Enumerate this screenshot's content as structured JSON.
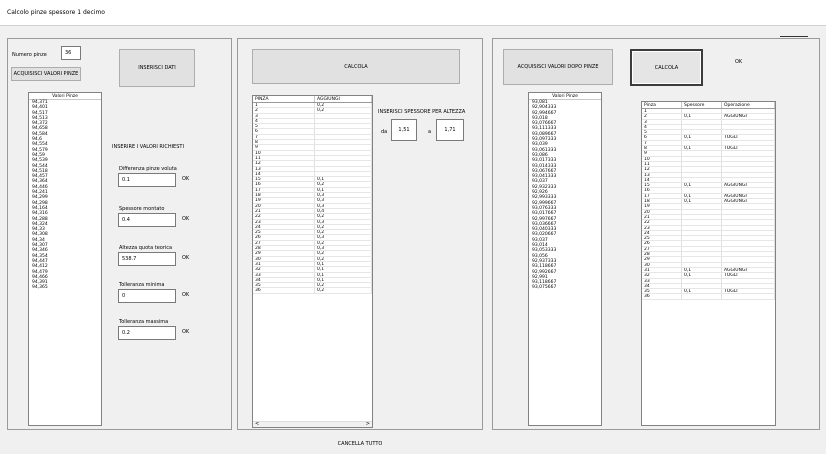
{
  "window": {
    "title": "Calcolo pinze spessore 1 decimo"
  },
  "left": {
    "numero_pinze_label": "Numero pinze",
    "numero_pinze_value": "36",
    "acquisisci_label": "ACQUISISCI VALORI PINZE",
    "inserisci_dati_label": "INSERISCI DATI",
    "valori_pinze_header": "Valori Pinze",
    "valori_pinze": [
      "94,371",
      "94,401",
      "94,517",
      "94,513",
      "94,372",
      "94,658",
      "94,584",
      "94,6",
      "94,554",
      "94,579",
      "94,59",
      "94,539",
      "94,544",
      "94,518",
      "94,457",
      "94,364",
      "94,446",
      "94,241",
      "94,299",
      "94,298",
      "94,164",
      "94,316",
      "94,288",
      "94,324",
      "94,33",
      "94,308",
      "94,34",
      "94,307",
      "94,346",
      "94,354",
      "94,447",
      "94,412",
      "94,479",
      "94,466",
      "94,391",
      "94,365"
    ],
    "inserire_label": "INSERIRE I VALORI RICHIESTI",
    "fields": [
      {
        "label": "Differenza pinze voluta",
        "value": "0.1",
        "ok": "OK"
      },
      {
        "label": "Spessore montato",
        "value": "0.4",
        "ok": "OK"
      },
      {
        "label": "Altezza quota teorica",
        "value": "538.7",
        "ok": "OK"
      },
      {
        "label": "Tolleranza minima",
        "value": "0",
        "ok": "OK"
      },
      {
        "label": "Tolleranza massima",
        "value": "0.2",
        "ok": "OK"
      }
    ]
  },
  "middle": {
    "calcola_label": "CALCOLA",
    "columns": [
      "PINZA",
      "AGGIUNGI"
    ],
    "rows": [
      [
        "1",
        "0,2"
      ],
      [
        "2",
        "0,2"
      ],
      [
        "3",
        ""
      ],
      [
        "4",
        ""
      ],
      [
        "5",
        ""
      ],
      [
        "6",
        ""
      ],
      [
        "7",
        ""
      ],
      [
        "8",
        ""
      ],
      [
        "9",
        ""
      ],
      [
        "10",
        ""
      ],
      [
        "11",
        ""
      ],
      [
        "12",
        ""
      ],
      [
        "13",
        ""
      ],
      [
        "14",
        ""
      ],
      [
        "15",
        "0,1"
      ],
      [
        "16",
        "0,2"
      ],
      [
        "17",
        "0,1"
      ],
      [
        "18",
        "0,3"
      ],
      [
        "19",
        "0,3"
      ],
      [
        "20",
        "0,3"
      ],
      [
        "21",
        "0,4"
      ],
      [
        "22",
        "0,2"
      ],
      [
        "23",
        "0,3"
      ],
      [
        "24",
        "0,2"
      ],
      [
        "25",
        "0,2"
      ],
      [
        "26",
        "0,3"
      ],
      [
        "27",
        "0,2"
      ],
      [
        "28",
        "0,3"
      ],
      [
        "29",
        "0,2"
      ],
      [
        "30",
        "0,2"
      ],
      [
        "31",
        "0,1"
      ],
      [
        "32",
        "0,1"
      ],
      [
        "33",
        "0,1"
      ],
      [
        "34",
        "0,1"
      ],
      [
        "35",
        "0,2"
      ],
      [
        "36",
        "0,2"
      ]
    ],
    "inserisci_spessore_label": "INSERISCI SPESSORE PER ALTEZZA",
    "da_label": "da",
    "da_value": "1,51",
    "a_label": "a",
    "a_value": "1,71",
    "scroll_left": "<",
    "scroll_right": ">"
  },
  "right": {
    "acquisisci_dopo_label": "ACQUISISCI VALORI DOPO PINZE",
    "calcola_label": "CALCOLA",
    "ok_label": "OK",
    "valori_pinze_header": "Valori Pinze",
    "valori_pinze": [
      "93,081",
      "92,904333",
      "92,994667",
      "93,018",
      "93,076667",
      "93,111333",
      "93,089667",
      "93,097333",
      "93,039",
      "93,061333",
      "93,086",
      "93,017333",
      "93,014333",
      "93,067667",
      "93,041333",
      "93,037",
      "92,932333",
      "92,926",
      "92,993333",
      "92,999667",
      "93,076333",
      "93,017667",
      "92,997667",
      "93,036667",
      "93,040333",
      "93,020667",
      "93,037",
      "93,014",
      "93,053333",
      "93,056",
      "92,937333",
      "93,118667",
      "92,992667",
      "92,991",
      "93,118667",
      "93,075667"
    ],
    "columns": [
      "Pinza",
      "Spessore",
      "Operazione"
    ],
    "rows": [
      [
        "1",
        "",
        ""
      ],
      [
        "2",
        "0,1",
        "AGGIUNGI"
      ],
      [
        "3",
        "",
        ""
      ],
      [
        "4",
        "",
        ""
      ],
      [
        "5",
        "",
        ""
      ],
      [
        "6",
        "0,1",
        "TOGLI"
      ],
      [
        "7",
        "",
        ""
      ],
      [
        "8",
        "0,1",
        "TOGLI"
      ],
      [
        "9",
        "",
        ""
      ],
      [
        "10",
        "",
        ""
      ],
      [
        "11",
        "",
        ""
      ],
      [
        "12",
        "",
        ""
      ],
      [
        "13",
        "",
        ""
      ],
      [
        "14",
        "",
        ""
      ],
      [
        "15",
        "0,1",
        "AGGIUNGI"
      ],
      [
        "16",
        "",
        ""
      ],
      [
        "17",
        "0,1",
        "AGGIUNGI"
      ],
      [
        "18",
        "0,1",
        "AGGIUNGI"
      ],
      [
        "19",
        "",
        ""
      ],
      [
        "20",
        "",
        ""
      ],
      [
        "21",
        "",
        ""
      ],
      [
        "22",
        "",
        ""
      ],
      [
        "23",
        "",
        ""
      ],
      [
        "24",
        "",
        ""
      ],
      [
        "25",
        "",
        ""
      ],
      [
        "26",
        "",
        ""
      ],
      [
        "27",
        "",
        ""
      ],
      [
        "28",
        "",
        ""
      ],
      [
        "29",
        "",
        ""
      ],
      [
        "30",
        "",
        ""
      ],
      [
        "31",
        "0,1",
        "AGGIUNGI"
      ],
      [
        "32",
        "0,1",
        "TOGLI"
      ],
      [
        "33",
        "",
        ""
      ],
      [
        "34",
        "",
        ""
      ],
      [
        "35",
        "0,1",
        "TOGLI"
      ],
      [
        "36",
        "",
        ""
      ]
    ]
  },
  "footer": {
    "cancella_label": "CANCELLA TUTTO"
  }
}
